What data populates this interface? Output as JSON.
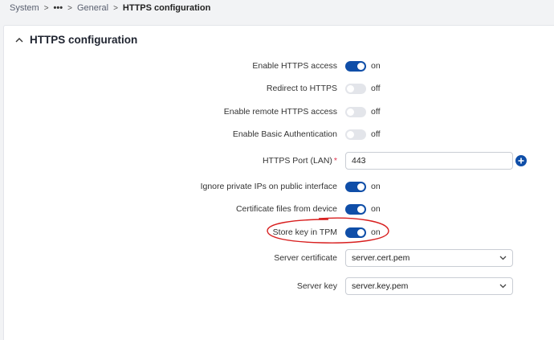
{
  "breadcrumb": {
    "root": "System",
    "ellipsis": "•••",
    "parent": "General",
    "current": "HTTPS configuration"
  },
  "panel": {
    "title": "HTTPS configuration"
  },
  "fields": {
    "enable_https": {
      "label": "Enable HTTPS access",
      "state": "on"
    },
    "redirect_https": {
      "label": "Redirect to HTTPS",
      "state": "off"
    },
    "remote_https": {
      "label": "Enable remote HTTPS access",
      "state": "off"
    },
    "basic_auth": {
      "label": "Enable Basic Authentication",
      "state": "off"
    },
    "https_port": {
      "label": "HTTPS Port (LAN)",
      "required_mark": "*",
      "value": "443"
    },
    "ignore_private_ips": {
      "label": "Ignore private IPs on public interface",
      "state": "on"
    },
    "cert_files_device": {
      "label": "Certificate files from device",
      "state": "on"
    },
    "store_key_tpm": {
      "label": "Store key in TPM",
      "state": "on"
    },
    "server_certificate": {
      "label": "Server certificate",
      "value": "server.cert.pem"
    },
    "server_key": {
      "label": "Server key",
      "value": "server.key.pem"
    }
  },
  "colors": {
    "accent": "#0f4ea8",
    "toggle_off": "#e3e5ea",
    "annotation": "#d81e1e",
    "required": "#e0334d"
  },
  "icons": {
    "collapse": "chevron-up-icon",
    "breadcrumb_separator": "chevron-right-icon",
    "add": "plus-circle-icon",
    "select": "chevron-down-icon"
  }
}
